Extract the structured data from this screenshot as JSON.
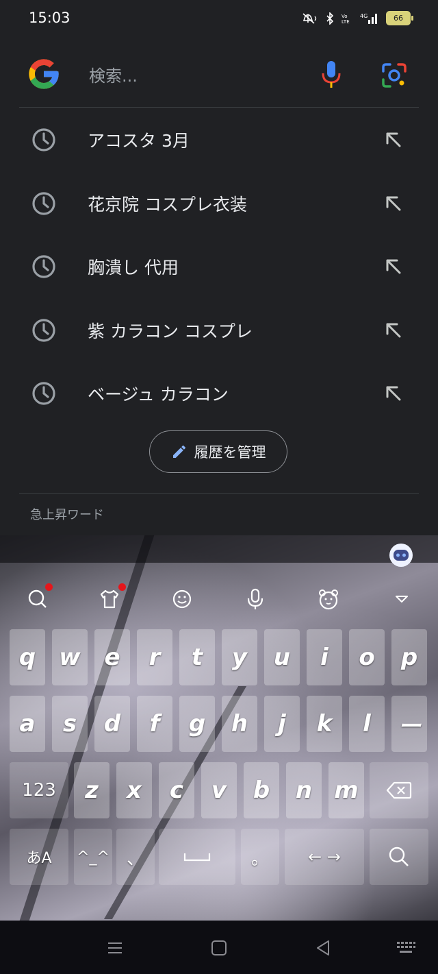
{
  "status_bar": {
    "time": "15:03",
    "battery": "66"
  },
  "search": {
    "placeholder": "検索..."
  },
  "history": [
    {
      "text": "アコスタ 3月"
    },
    {
      "text": "花京院 コスプレ衣装"
    },
    {
      "text": "胸潰し 代用"
    },
    {
      "text": "紫 カラコン コスプレ"
    },
    {
      "text": "ベージュ カラコン"
    }
  ],
  "manage_history": {
    "label": "履歴を管理"
  },
  "trending": {
    "label": "急上昇ワード"
  },
  "keyboard": {
    "row1": [
      "q",
      "w",
      "e",
      "r",
      "t",
      "y",
      "u",
      "i",
      "o",
      "p"
    ],
    "row2": [
      "a",
      "s",
      "d",
      "f",
      "g",
      "h",
      "j",
      "k",
      "l",
      "ー"
    ],
    "row3": [
      "z",
      "x",
      "c",
      "v",
      "b",
      "n",
      "m"
    ],
    "numbers_label": "123",
    "lang_label": "あA",
    "emoticon_label": "^_^",
    "comma_label": "、",
    "period_label": "。",
    "arrows_label": "←  →"
  },
  "colors": {
    "background": "#202124",
    "text": "#e8eaed",
    "muted": "#9aa0a6",
    "google_blue": "#4285f4",
    "google_red": "#ea4335",
    "google_yellow": "#fbbc05",
    "google_green": "#34a853",
    "notification_dot": "#e5161b"
  },
  "icons": {
    "status": [
      "mute-icon",
      "bluetooth-icon",
      "volte-icon",
      "4g-signal-icon",
      "battery-icon"
    ],
    "search_row": [
      "google-logo",
      "mic-icon",
      "lens-icon"
    ],
    "history": [
      "clock-icon",
      "fill-arrow-icon"
    ],
    "keyboard_toolbar": [
      "search-icon",
      "theme-icon",
      "emoji-icon",
      "voice-icon",
      "bear-icon",
      "collapse-icon",
      "assistant-bot-icon"
    ],
    "nav": [
      "recents-icon",
      "home-icon",
      "back-icon",
      "keyboard-switch-icon"
    ]
  }
}
